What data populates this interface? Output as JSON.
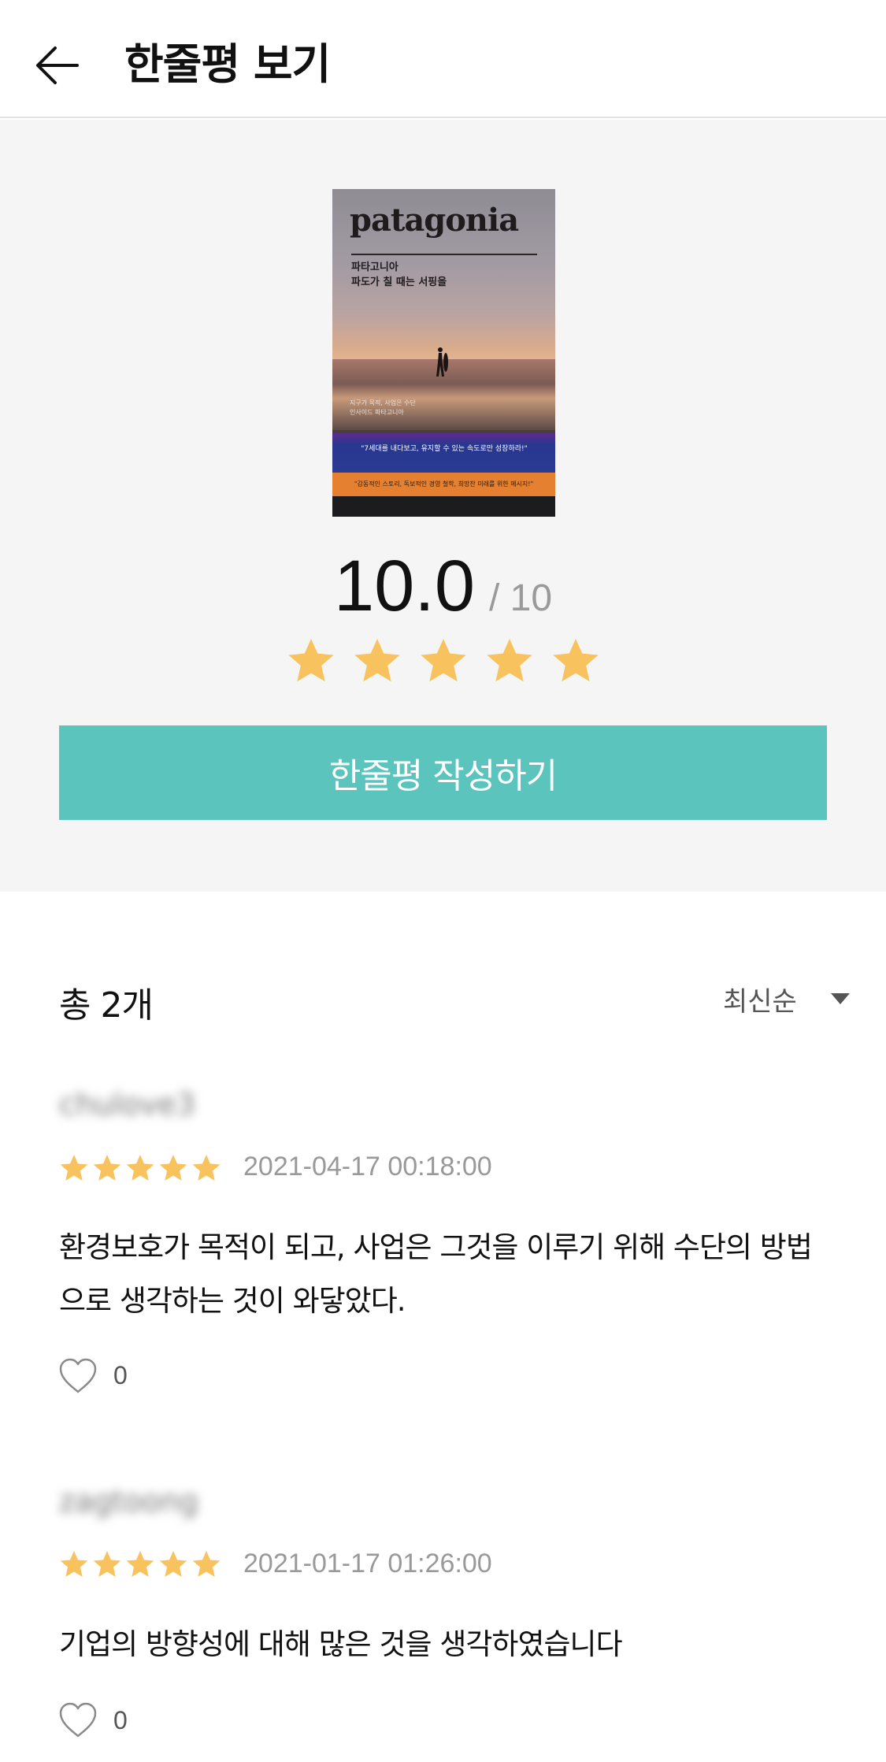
{
  "header": {
    "title": "한줄평 보기",
    "back_icon": "arrow-left-icon"
  },
  "book": {
    "cover_brand": "patagonia",
    "cover_subtitle_1": "파타고니아",
    "cover_subtitle_2": "파도가 칠 때는 서핑을",
    "cover_note_1": "지구가 목적, 사업은 수단",
    "cover_note_2": "인사이드 파타고니아",
    "cover_quote_blue": "\"7세대를 내다보고, 유지할 수 있는 속도로만 성장하라!\"",
    "cover_quote_orange": "\"감동적인 스토리, 독보적인 경영 철학, 희망찬 미래를 위한 메시지!\""
  },
  "rating": {
    "score": "10.0",
    "out_of": "/ 10",
    "stars": 5,
    "star_color": "#f8c35e"
  },
  "write_button": {
    "label": "한줄평 작성하기",
    "color": "#5bc4bd"
  },
  "list": {
    "count_label": "총 2개",
    "sort_label": "최신순"
  },
  "reviews": [
    {
      "user": "chulove3",
      "stars": 5,
      "date": "2021-04-17 00:18:00",
      "text": "환경보호가 목적이 되고, 사업은 그것을 이루기 위해 수단의 방법으로 생각하는 것이 와닿았다.",
      "likes": "0"
    },
    {
      "user": "zagtoong",
      "stars": 5,
      "date": "2021-01-17 01:26:00",
      "text": "기업의 방향성에 대해 많은 것을 생각하였습니다",
      "likes": "0"
    }
  ]
}
